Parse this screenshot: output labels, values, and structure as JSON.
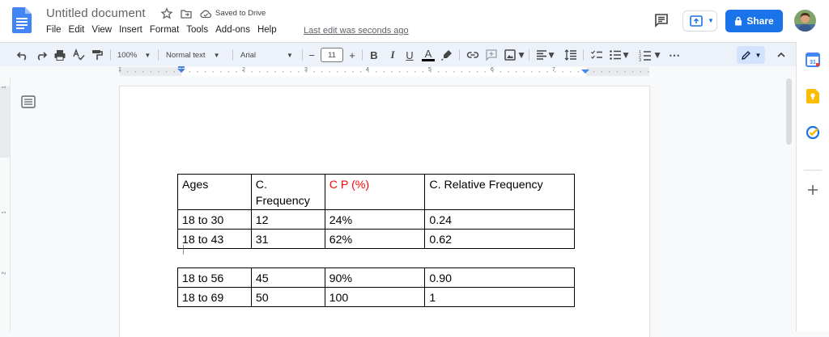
{
  "header": {
    "doc_title": "Untitled document",
    "saved_status": "Saved to Drive",
    "menu": [
      "File",
      "Edit",
      "View",
      "Insert",
      "Format",
      "Tools",
      "Add-ons",
      "Help"
    ],
    "last_edit": "Last edit was seconds ago",
    "share_label": "Share"
  },
  "toolbar": {
    "zoom": "100%",
    "style": "Normal text",
    "font": "Arial",
    "font_size": "11",
    "minus": "−",
    "plus": "+",
    "bold": "B",
    "italic": "I",
    "underline": "U",
    "text_color": "A",
    "more": "⋯"
  },
  "ruler": {
    "numbers": [
      "1",
      "1",
      "2",
      "3",
      "4",
      "5",
      "6",
      "7"
    ],
    "left_numbers": [
      "1",
      "1",
      "2"
    ]
  },
  "table1": {
    "rows": [
      [
        "Ages",
        "C.\nFrequency",
        "C P (%)",
        "C. Relative Frequency"
      ],
      [
        "18 to 30",
        "12",
        "24%",
        "0.24"
      ],
      [
        "18 to 43",
        "31",
        "62%",
        "0.62"
      ]
    ]
  },
  "table2": {
    "rows": [
      [
        "18 to 56",
        "45",
        "90%",
        "0.90"
      ],
      [
        "18 to 69",
        "50",
        "100",
        "1"
      ]
    ]
  },
  "colors": {
    "accent": "#1a73e8",
    "red_text": "#ff0000",
    "toolbar_bg": "#edf2fa"
  }
}
